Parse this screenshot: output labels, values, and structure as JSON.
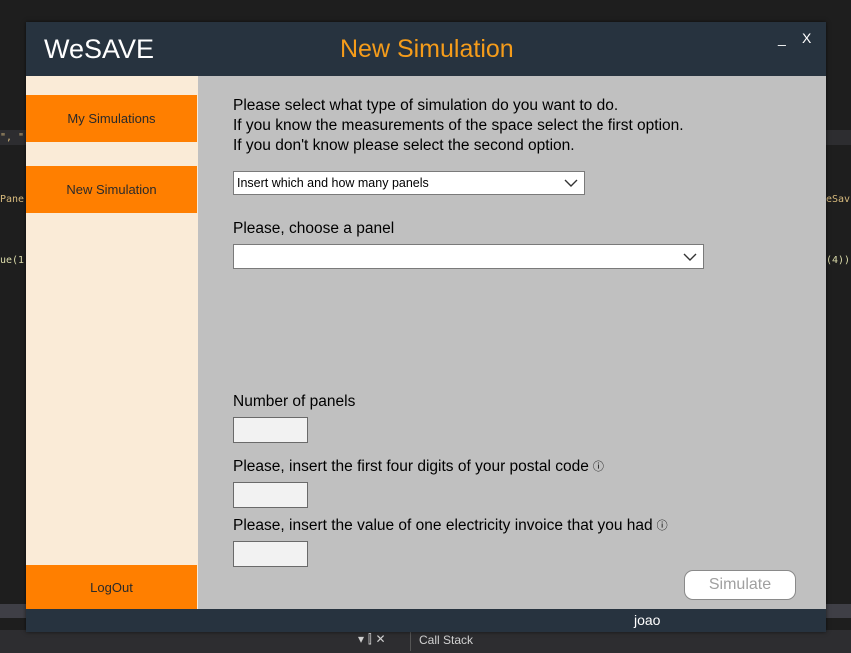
{
  "ide": {
    "frag_quote": "\", \"",
    "frag_pane": "Pane",
    "frag_ue": "ue(1",
    "frag_nesav": "eSav",
    "frag_four": "(4)).",
    "bottom_tab": "Call Stack",
    "bottom_tools": "▾ ⫿ ✕"
  },
  "app": {
    "brand": "WeSAVE",
    "title": "New Simulation",
    "minimize": "_",
    "close": "X",
    "user": "joao"
  },
  "sidebar": {
    "my_simulations": "My Simulations",
    "new_simulation": "New Simulation",
    "logout": "LogOut"
  },
  "main": {
    "intro": [
      "Please select what type of simulation do you want to do.",
      "If you know the measurements of the space select the first option.",
      "If you don't know please select the second option."
    ],
    "simulation_type": "Insert which and how many panels",
    "choose_panel_label": "Please, choose a panel",
    "choose_panel_value": "",
    "number_of_panels_label": "Number of panels",
    "postal_code_label": "Please, insert the first four digits of your postal code",
    "invoice_label": "Please, insert the value of one electricity invoice that you had",
    "info_symbol": "ⓘ",
    "simulate_button": "Simulate"
  },
  "colors": {
    "titlebar": "#27333f",
    "accent_orange": "#ff7f00",
    "title_orange": "#f59c1a",
    "sidebar_bg": "#faebd7",
    "main_bg": "#c0c0c0"
  }
}
